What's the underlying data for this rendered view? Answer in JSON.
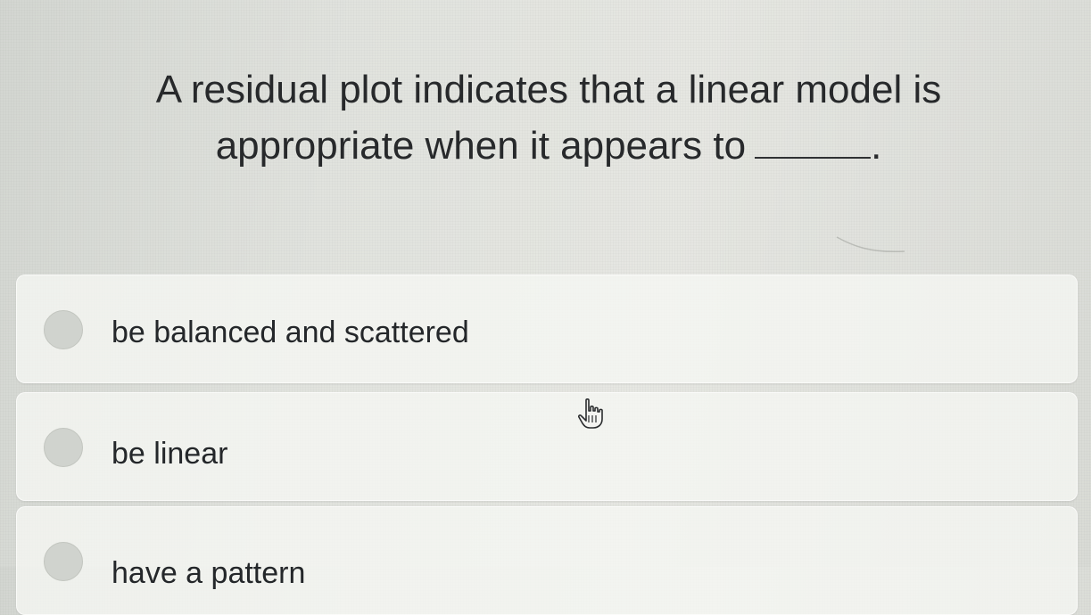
{
  "question": {
    "line1": "A residual plot indicates that a linear model is",
    "line2": "appropriate when it appears to",
    "trailing_punctuation": "."
  },
  "options": [
    {
      "label": "be balanced and scattered",
      "selected": false
    },
    {
      "label": "be linear",
      "selected": false
    },
    {
      "label": "have a pattern",
      "selected": false
    }
  ],
  "icons": {
    "cursor": "hand-pointer-icon"
  }
}
